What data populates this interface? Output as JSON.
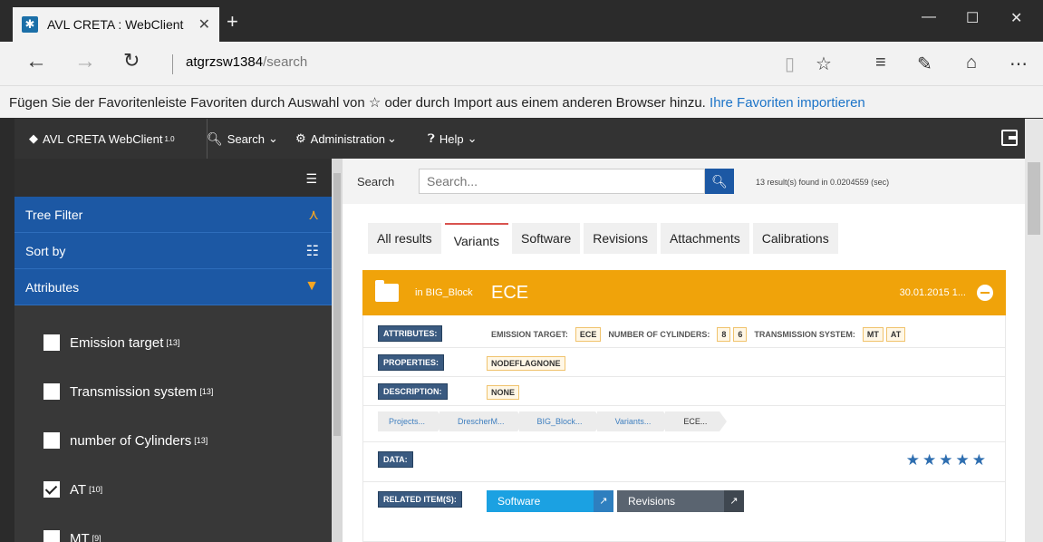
{
  "browser": {
    "tab_title": "AVL CRETA : WebClient",
    "url_host": "atgrzsw1384",
    "url_path": "/search",
    "favbar_text": "Fügen Sie der Favoritenleiste Favoriten durch Auswahl von ☆ oder durch Import aus einem anderen Browser hinzu.",
    "favbar_link": "Ihre Favoriten importieren"
  },
  "appnav": {
    "brand": "AVL CRETA WebClient",
    "brand_version": "1.0",
    "search": "Search",
    "administration": "Administration",
    "help": "Help"
  },
  "sidebar": {
    "tree_filter": "Tree Filter",
    "sort_by": "Sort by",
    "attributes": "Attributes",
    "items": [
      {
        "label": "Emission target",
        "count": "[13]",
        "checked": false
      },
      {
        "label": "Transmission system",
        "count": "[13]",
        "checked": false
      },
      {
        "label": "number of Cylinders",
        "count": "[13]",
        "checked": false
      },
      {
        "label": "AT",
        "count": "[10]",
        "checked": true
      },
      {
        "label": "MT",
        "count": "[9]",
        "checked": false
      }
    ]
  },
  "search": {
    "label": "Search",
    "placeholder": "Search...",
    "result_info": "13 result(s) found in 0.0204559 (sec)"
  },
  "tabs": [
    "All results",
    "Variants",
    "Software",
    "Revisions",
    "Attachments",
    "Calibrations"
  ],
  "active_tab": "Variants",
  "card": {
    "in_label": "in BIG_Block",
    "title": "ECE",
    "date": "30.01.2015 1...",
    "attributes_label": "ATTRIBUTES:",
    "attributes": [
      "EMISSION TARGET:",
      "ECE",
      "NUMBER OF CYLINDERS:",
      "8",
      "6",
      "TRANSMISSION SYSTEM:",
      "MT",
      "AT"
    ],
    "properties_label": "PROPERTIES:",
    "properties": "NODEFLAGNONE",
    "description_label": "DESCRIPTION:",
    "description": "NONE",
    "breadcrumbs": [
      "Projects...",
      "DrescherM...",
      "BIG_Block...",
      "Variants...",
      "ECE..."
    ],
    "data_label": "DATA:",
    "rating": 5,
    "related_label": "RELATED ITEM(S):",
    "related": [
      "Software",
      "Revisions"
    ]
  },
  "colors": {
    "primary": "#1c58a4",
    "card_header": "#f0a30a",
    "related_software": "#1ba1e2",
    "related_revisions": "#5a6470"
  }
}
